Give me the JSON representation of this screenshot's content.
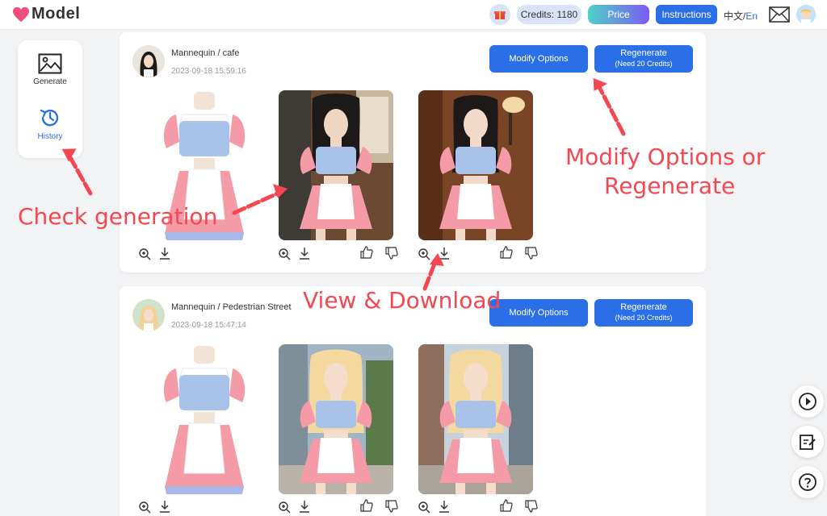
{
  "header": {
    "logo_text": "Model",
    "credits_label": "Credits: 1180",
    "price_label": "Price",
    "instructions_label": "Instructions",
    "lang_zh": "中文/",
    "lang_en": "En"
  },
  "sidebar": {
    "items": [
      {
        "label": "Generate"
      },
      {
        "label": "History"
      }
    ]
  },
  "cards": [
    {
      "title": "Mannequin / cafe",
      "time": "2023-09-18 15:59:16",
      "modify_label": "Modify Options",
      "regen_label": "Regenerate",
      "regen_sub": "(Need 20 Credits)"
    },
    {
      "title": "Mannequin / Pedestrian Street",
      "time": "2023-09-18 15:47:14",
      "modify_label": "Modify Options",
      "regen_label": "Regenerate",
      "regen_sub": "(Need 20 Credits)"
    }
  ],
  "annotations": {
    "check_generation": "Check generation",
    "modify_regen_1": "Modify Options or",
    "modify_regen_2": "Regenerate",
    "view_download": "View & Download"
  },
  "colors": {
    "primary": "#2b6fe8",
    "annotation": "#f5474f",
    "logo_heart": "#f04e7a"
  }
}
